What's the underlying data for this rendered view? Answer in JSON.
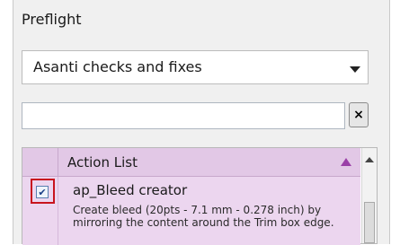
{
  "panel": {
    "title": "Preflight",
    "dropdown_value": "Asanti checks and fixes",
    "search": {
      "value": "",
      "placeholder": ""
    },
    "clear_button": "×"
  },
  "action_list": {
    "header": "Action List",
    "items": [
      {
        "checked": true,
        "checkmark": "✔",
        "name": "ap_Bleed creator",
        "description": "Create bleed (20pts - 7.1 mm - 0.278 inch) by mirroring the content around the Trim box edge."
      }
    ]
  },
  "colors": {
    "header_bg": "#e2c8e6",
    "row_bg": "#ecd6ef",
    "sort_arrow": "#9a3fa7",
    "highlight": "#c8141e"
  }
}
